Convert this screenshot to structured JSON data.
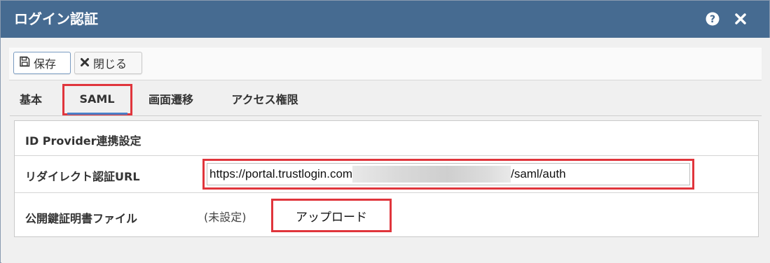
{
  "window": {
    "title": "ログイン認証",
    "help_icon": "question-circle-icon",
    "close_icon": "close-x-icon"
  },
  "toolbar": {
    "save_label": "保存",
    "save_icon": "floppy-disk-icon",
    "close_label": "閉じる",
    "close_icon": "x-mark-icon"
  },
  "tabs": [
    {
      "label": "基本",
      "active": false
    },
    {
      "label": "SAML",
      "active": true
    },
    {
      "label": "画面遷移",
      "active": false
    },
    {
      "label": "アクセス権限",
      "active": false
    }
  ],
  "panel": {
    "section_title": "ID Provider連携設定",
    "redirect_label": "リダイレクト認証URL",
    "redirect_url_prefix": "https://portal.trustlogin.com",
    "redirect_url_suffix": "/saml/auth",
    "cert_label": "公開鍵証明書ファイル",
    "cert_status": "(未設定)",
    "upload_label": "アップロード"
  },
  "colors": {
    "titlebar": "#466b91",
    "highlight": "#e0353c",
    "active_tab_underline": "#4a80c8"
  }
}
